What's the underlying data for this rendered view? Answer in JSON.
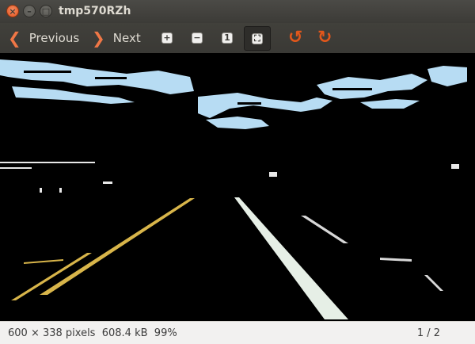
{
  "window": {
    "title": "tmp570RZh",
    "close_glyph": "×",
    "min_glyph": "–",
    "max_glyph": "□"
  },
  "toolbar": {
    "prev_label": "Previous",
    "next_label": "Next",
    "prev_icon": "chevron-left-icon",
    "next_icon": "chevron-right-icon",
    "zoom_in_icon": "zoom-in-icon",
    "zoom_out_icon": "zoom-out-icon",
    "zoom_normal_icon": "zoom-normal-icon",
    "zoom_fit_icon": "zoom-fit-icon",
    "rotate_left_icon": "rotate-left-icon",
    "rotate_right_icon": "rotate-right-icon",
    "accent": "#f07746"
  },
  "image": {
    "description_icon": "road-photo-icon"
  },
  "status": {
    "dimensions": "600 × 338 pixels",
    "file_size": "608.4 kB",
    "zoom": "99%",
    "position": "1 / 2"
  }
}
